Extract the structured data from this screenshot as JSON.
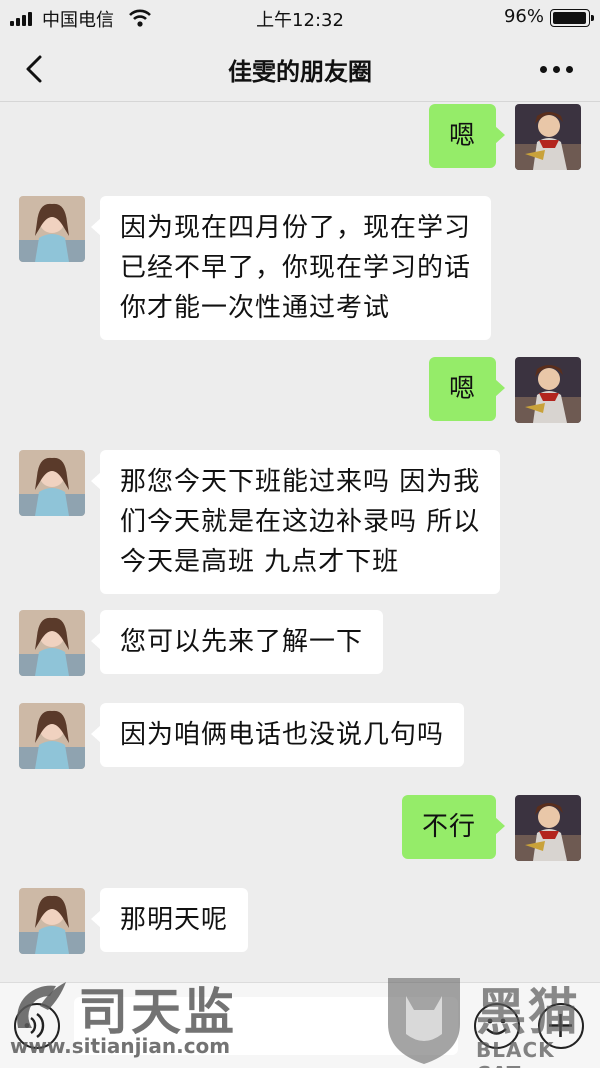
{
  "status_bar": {
    "carrier": "中国电信",
    "time": "上午12:32",
    "battery_percent": "96%",
    "battery_level": 0.96
  },
  "nav": {
    "title": "佳雯的朋友圈"
  },
  "messages": [
    {
      "direction": "out",
      "text": "嗯"
    },
    {
      "direction": "in",
      "text": "因为现在四月份了，现在学习\n已经不早了，你现在学习的话\n你才能一次性通过考试"
    },
    {
      "direction": "out",
      "text": "嗯"
    },
    {
      "direction": "in",
      "text": "那您今天下班能过来吗  因为我\n们今天就是在这边补录吗   所以\n今天是高班  九点才下班"
    },
    {
      "direction": "in",
      "text": "您可以先来了解一下"
    },
    {
      "direction": "in",
      "text": "因为咱俩电话也没说几句吗"
    },
    {
      "direction": "out",
      "text": "不行"
    },
    {
      "direction": "in",
      "text": "那明天呢"
    }
  ],
  "watermarks": {
    "left_brand": "司天监",
    "left_url": "www.sitianjian.com",
    "right_brand_cn": "黑猫",
    "right_brand_en": "BLACK CAT"
  },
  "colors": {
    "background": "#ededed",
    "outgoing_bubble": "#95ec69",
    "incoming_bubble": "#ffffff"
  },
  "icons": {
    "back": "chevron-left-icon",
    "more": "more-dots-icon",
    "voice": "voice-icon",
    "emoji": "emoji-icon",
    "plus": "plus-icon"
  }
}
